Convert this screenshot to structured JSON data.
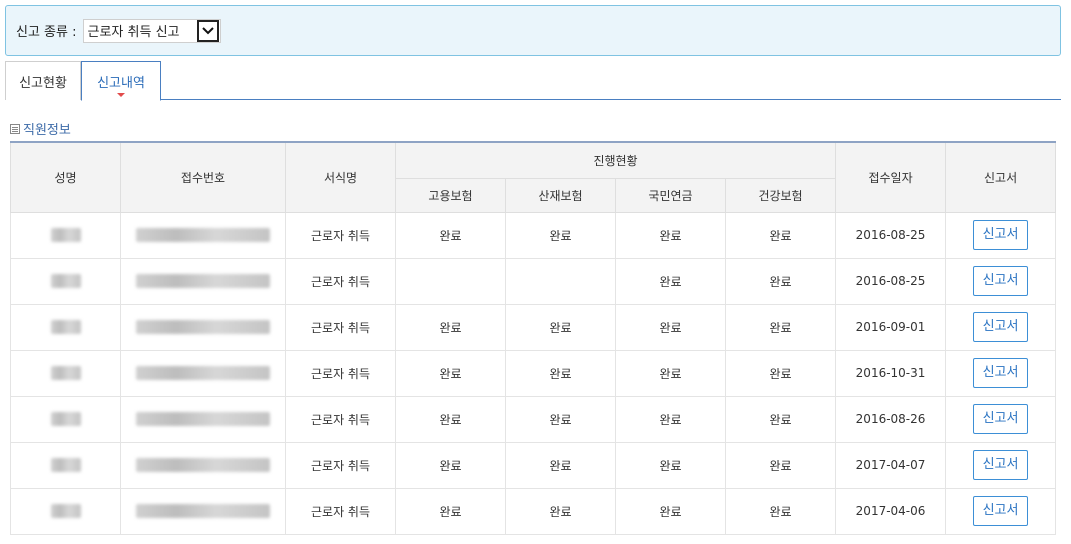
{
  "filter": {
    "label": "신고 종류 :",
    "selected": "근로자 취득 신고"
  },
  "tabs": [
    {
      "label": "신고현황",
      "active": false
    },
    {
      "label": "신고내역",
      "active": true
    }
  ],
  "section": {
    "title": "직원정보"
  },
  "table": {
    "headers": {
      "name": "성명",
      "receipt_no": "접수번호",
      "form_name": "서식명",
      "progress": "진행현황",
      "employment": "고용보험",
      "industrial": "산재보험",
      "pension": "국민연금",
      "health": "건강보험",
      "receipt_date": "접수일자",
      "report": "신고서"
    },
    "rows": [
      {
        "name": "",
        "receipt_no": "",
        "form_name": "근로자 취득",
        "employment": "완료",
        "industrial": "완료",
        "pension": "완료",
        "health": "완료",
        "receipt_date": "2016-08-25",
        "report": "신고서"
      },
      {
        "name": "",
        "receipt_no": "",
        "form_name": "근로자 취득",
        "employment": "",
        "industrial": "",
        "pension": "완료",
        "health": "완료",
        "receipt_date": "2016-08-25",
        "report": "신고서"
      },
      {
        "name": "",
        "receipt_no": "",
        "form_name": "근로자 취득",
        "employment": "완료",
        "industrial": "완료",
        "pension": "완료",
        "health": "완료",
        "receipt_date": "2016-09-01",
        "report": "신고서"
      },
      {
        "name": "",
        "receipt_no": "",
        "form_name": "근로자 취득",
        "employment": "완료",
        "industrial": "완료",
        "pension": "완료",
        "health": "완료",
        "receipt_date": "2016-10-31",
        "report": "신고서"
      },
      {
        "name": "",
        "receipt_no": "",
        "form_name": "근로자 취득",
        "employment": "완료",
        "industrial": "완료",
        "pension": "완료",
        "health": "완료",
        "receipt_date": "2016-08-26",
        "report": "신고서"
      },
      {
        "name": "",
        "receipt_no": "",
        "form_name": "근로자 취득",
        "employment": "완료",
        "industrial": "완료",
        "pension": "완료",
        "health": "완료",
        "receipt_date": "2017-04-07",
        "report": "신고서"
      },
      {
        "name": "",
        "receipt_no": "",
        "form_name": "근로자 취득",
        "employment": "완료",
        "industrial": "완료",
        "pension": "완료",
        "health": "완료",
        "receipt_date": "2017-04-06",
        "report": "신고서"
      }
    ]
  },
  "colors": {
    "accent": "#2a6bb8",
    "filter_bg": "#eaf5fb",
    "tab_marker": "#e24b4b"
  }
}
